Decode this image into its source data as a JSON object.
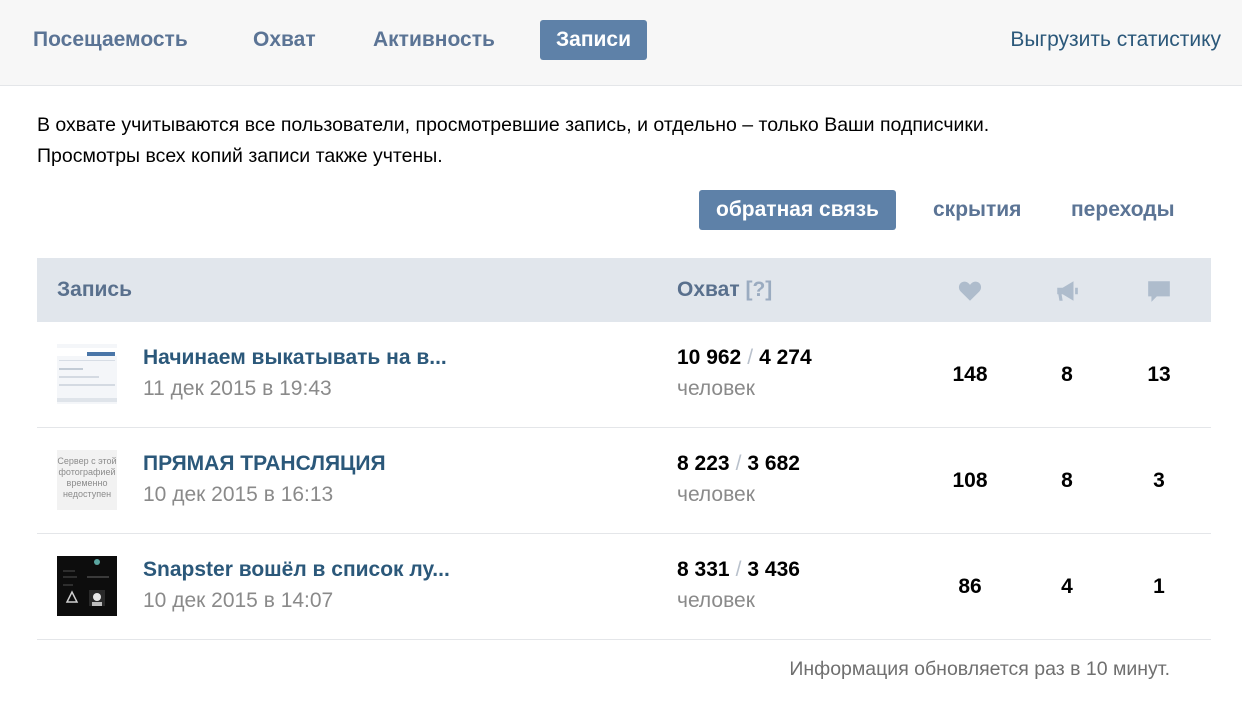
{
  "tabs": [
    {
      "label": "Посещаемость",
      "active": false
    },
    {
      "label": "Охват",
      "active": false
    },
    {
      "label": "Активность",
      "active": false
    },
    {
      "label": "Записи",
      "active": true
    }
  ],
  "export_label": "Выгрузить статистику",
  "description": {
    "line1": "В охвате учитываются все пользователи, просмотревшие запись, и отдельно – только Ваши подписчики.",
    "line2": "Просмотры всех копий записи также учтены."
  },
  "filters": [
    {
      "label": "обратная связь",
      "active": true
    },
    {
      "label": "скрытия",
      "active": false
    },
    {
      "label": "переходы",
      "active": false
    }
  ],
  "table": {
    "header": {
      "post": "Запись",
      "reach": "Охват",
      "reach_help": "[?]",
      "icons": [
        "heart-icon",
        "megaphone-icon",
        "comment-icon"
      ]
    },
    "rows": [
      {
        "title": "Начинаем выкатывать на в...",
        "date": "11 дек 2015 в 19:43",
        "reach_total": "10 962",
        "separator": "/",
        "reach_subscribers": "4 274",
        "unit": "человек",
        "likes": "148",
        "shares": "8",
        "comments": "13"
      },
      {
        "title": "ПРЯМАЯ ТРАНСЛЯЦИЯ",
        "date": "10 дек 2015 в 16:13",
        "reach_total": "8 223",
        "separator": "/",
        "reach_subscribers": "3 682",
        "unit": "человек",
        "likes": "108",
        "shares": "8",
        "comments": "3",
        "thumb_text": [
          "Сервер с этой",
          "фотографией",
          "временно",
          "недоступен"
        ]
      },
      {
        "title": "Snapster вошёл в список лу...",
        "date": "10 дек 2015 в 14:07",
        "reach_total": "8 331",
        "separator": "/",
        "reach_subscribers": "3 436",
        "unit": "человек",
        "likes": "86",
        "shares": "4",
        "comments": "1"
      }
    ]
  },
  "footer_note": "Информация обновляется раз в 10 минут.",
  "colors": {
    "accent": "#5e81a8",
    "link": "#2b587a",
    "tab_text": "#5b7495",
    "header_bg": "#e1e6ec",
    "muted": "#8a8a8a"
  }
}
